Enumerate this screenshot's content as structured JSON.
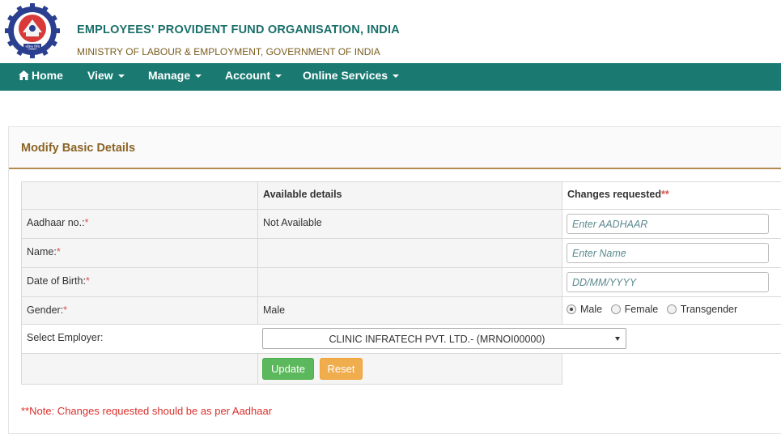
{
  "header": {
    "org_title": "EMPLOYEES' PROVIDENT FUND ORGANISATION, INDIA",
    "ministry": "MINISTRY OF LABOUR & EMPLOYMENT, GOVERNMENT OF INDIA",
    "logo_caption": "भविष्य निधि"
  },
  "nav": {
    "home": "Home",
    "view": "View",
    "manage": "Manage",
    "account": "Account",
    "online_services": "Online Services"
  },
  "panel": {
    "title": "Modify Basic Details"
  },
  "table": {
    "col_available": "Available details",
    "col_changes": "Changes requested",
    "col_changes_marker": "**",
    "required_marker": "*",
    "rows": {
      "aadhaar": {
        "label": "Aadhaar no.:",
        "available": "Not Available",
        "placeholder": "Enter AADHAAR"
      },
      "name": {
        "label": "Name:",
        "available": "",
        "placeholder": "Enter Name"
      },
      "dob": {
        "label": "Date of Birth:",
        "available": "",
        "placeholder": "DD/MM/YYYY"
      },
      "gender": {
        "label": "Gender:",
        "available": "Male",
        "options": [
          "Male",
          "Female",
          "Transgender"
        ],
        "selected": "Male"
      },
      "employer": {
        "label": "Select Employer:",
        "selected": "CLINIC INFRATECH PVT. LTD.- (MRNOI00000)"
      }
    }
  },
  "buttons": {
    "update": "Update",
    "reset": "Reset"
  },
  "note": "**Note: Changes requested should be as per Aadhaar",
  "colors": {
    "nav_bg": "#1a7a72",
    "title_brown": "#8a6424",
    "update_green": "#5cb85c",
    "reset_orange": "#f0ad4e",
    "note_red": "#d9302c"
  }
}
